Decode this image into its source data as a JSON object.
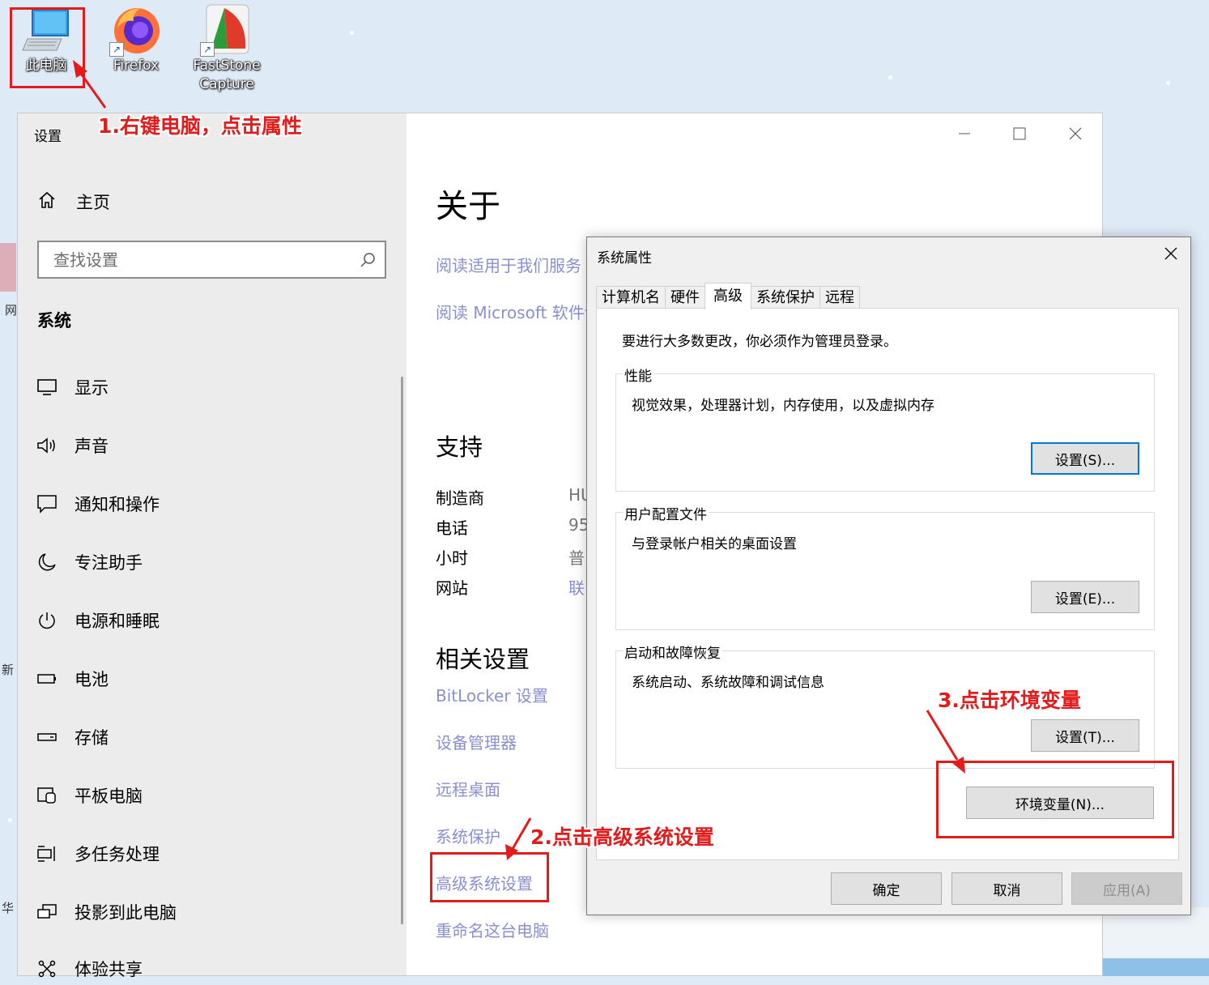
{
  "desktop": {
    "icons": [
      {
        "label": "此电脑",
        "icon": "this-pc-icon"
      },
      {
        "label": "Firefox",
        "icon": "firefox-icon"
      },
      {
        "label_line1": "FastStone",
        "label_line2": "Capture",
        "icon": "faststone-capture-icon"
      }
    ],
    "edge_fragments": [
      "网",
      "新",
      "华"
    ]
  },
  "settings": {
    "window_title": "设置",
    "home_label": "主页",
    "search_placeholder": "查找设置",
    "section_header": "系统",
    "nav": [
      {
        "label": "显示",
        "icon": "monitor-icon"
      },
      {
        "label": "声音",
        "icon": "speaker-icon"
      },
      {
        "label": "通知和操作",
        "icon": "notification-icon"
      },
      {
        "label": "专注助手",
        "icon": "moon-icon"
      },
      {
        "label": "电源和睡眠",
        "icon": "power-icon"
      },
      {
        "label": "电池",
        "icon": "battery-icon"
      },
      {
        "label": "存储",
        "icon": "storage-icon"
      },
      {
        "label": "平板电脑",
        "icon": "tablet-icon"
      },
      {
        "label": "多任务处理",
        "icon": "multitask-icon"
      },
      {
        "label": "投影到此电脑",
        "icon": "project-icon"
      },
      {
        "label": "体验共享",
        "icon": "share-icon"
      }
    ],
    "main": {
      "title": "关于",
      "links_top": [
        "阅读适用于我们服务",
        "阅读 Microsoft 软件许"
      ],
      "support_header": "支持",
      "support_rows": [
        {
          "label": "制造商",
          "value": "HU"
        },
        {
          "label": "电话",
          "value": "95"
        },
        {
          "label": "小时",
          "value": "普"
        },
        {
          "label": "网站",
          "value": "联"
        }
      ],
      "related_header": "相关设置",
      "related_links": [
        "BitLocker 设置",
        "设备管理器",
        "远程桌面",
        "系统保护",
        "高级系统设置",
        "重命名这台电脑"
      ]
    }
  },
  "dialog": {
    "title": "系统属性",
    "tabs": [
      "计算机名",
      "硬件",
      "高级",
      "系统保护",
      "远程"
    ],
    "active_tab": "高级",
    "admin_note": "要进行大多数更改，你必须作为管理员登录。",
    "groups": [
      {
        "label": "性能",
        "desc": "视觉效果，处理器计划，内存使用，以及虚拟内存",
        "button": "设置(S)..."
      },
      {
        "label": "用户配置文件",
        "desc": "与登录帐户相关的桌面设置",
        "button": "设置(E)..."
      },
      {
        "label": "启动和故障恢复",
        "desc": "系统启动、系统故障和调试信息",
        "button": "设置(T)..."
      }
    ],
    "env_button": "环境变量(N)...",
    "ok_button": "确定",
    "cancel_button": "取消",
    "apply_button": "应用(A)"
  },
  "annotations": {
    "step1": "1.右键电脑，点击属性",
    "step2": "2.点击高级系统设置",
    "step3": "3.点击环境变量",
    "color": "#e41b1b"
  }
}
